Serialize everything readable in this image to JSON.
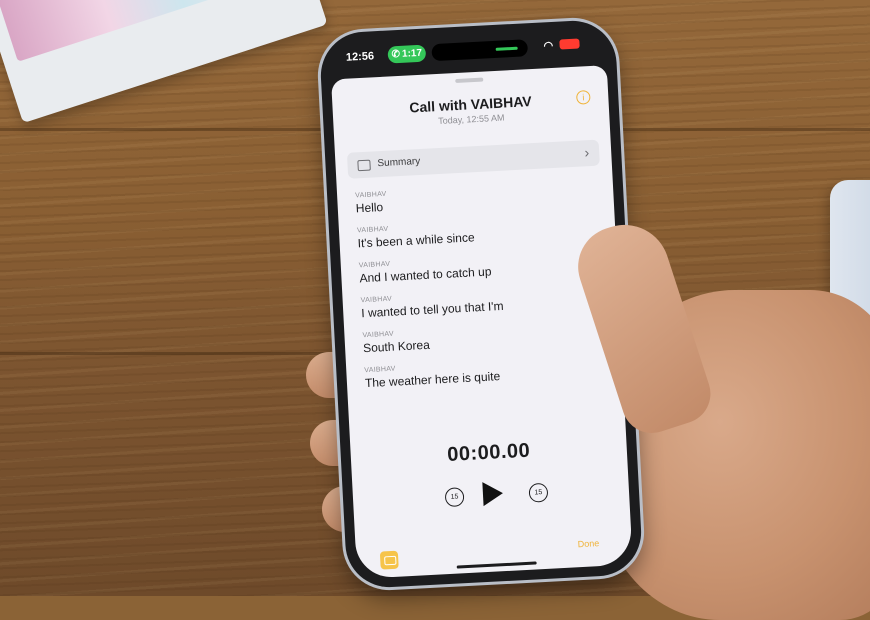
{
  "status_bar": {
    "time": "12:56",
    "call_duration": "1:17"
  },
  "call_sheet": {
    "title": "Call with VAIBHAV",
    "subtitle": "Today, 12:55 AM",
    "summary_label": "Summary",
    "transcript": [
      {
        "speaker": "VAIBHAV",
        "text": "Hello"
      },
      {
        "speaker": "VAIBHAV",
        "text": "It's been a while since"
      },
      {
        "speaker": "VAIBHAV",
        "text": "And I wanted to catch up"
      },
      {
        "speaker": "VAIBHAV",
        "text": "I wanted to tell you that I'm"
      },
      {
        "speaker": "VAIBHAV",
        "text": "South Korea"
      },
      {
        "speaker": "VAIBHAV",
        "text": "The weather here is quite"
      }
    ],
    "timer": "00:00.00",
    "skip_back_label": "15",
    "skip_forward_label": "15",
    "done_label": "Done"
  },
  "colors": {
    "accent": "#f0b43a",
    "call_green": "#34c759"
  },
  "icons": [
    "phone-icon",
    "wifi-icon",
    "battery-icon",
    "info-icon",
    "summary-icon",
    "chevron-right-icon",
    "skip-back-15-icon",
    "play-icon",
    "skip-forward-15-icon",
    "transcript-icon"
  ]
}
